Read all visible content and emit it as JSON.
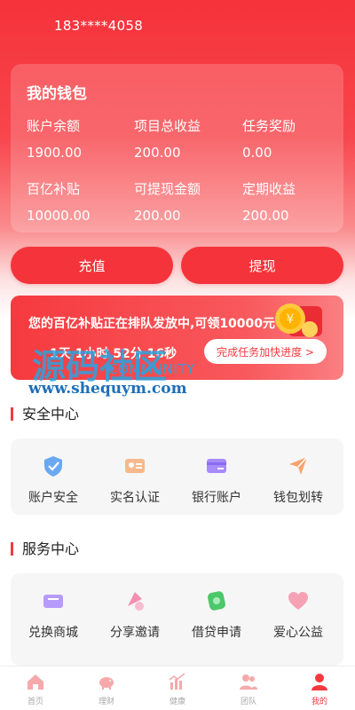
{
  "header": {
    "phone": "183****4058"
  },
  "wallet": {
    "title": "我的钱包",
    "stats": [
      {
        "label": "账户余额",
        "value": "1900.00"
      },
      {
        "label": "项目总收益",
        "value": "200.00"
      },
      {
        "label": "任务奖励",
        "value": "0.00"
      },
      {
        "label": "百亿补贴",
        "value": "10000.00"
      },
      {
        "label": "可提现金额",
        "value": "200.00"
      },
      {
        "label": "定期收益",
        "value": "200.00"
      }
    ]
  },
  "actions": {
    "recharge": "充值",
    "withdraw": "提现"
  },
  "banner": {
    "text": "您的百亿补贴正在排队发放中,可领10000元",
    "countdown": "1天 1小时 52分 16秒",
    "button": "完成任务加快进度 >"
  },
  "watermark": {
    "title": "源码社区",
    "sub": "COMMUNITY",
    "url": "www.shequym.com"
  },
  "security": {
    "title": "安全中心",
    "items": [
      {
        "label": "账户安全",
        "icon": "shield-icon"
      },
      {
        "label": "实名认证",
        "icon": "id-card-icon"
      },
      {
        "label": "银行账户",
        "icon": "bank-card-icon"
      },
      {
        "label": "钱包划转",
        "icon": "transfer-icon"
      }
    ]
  },
  "services": {
    "title": "服务中心",
    "items": [
      {
        "label": "兑换商城",
        "icon": "gift-card-icon"
      },
      {
        "label": "分享邀请",
        "icon": "share-icon"
      },
      {
        "label": "借贷申请",
        "icon": "loan-icon"
      },
      {
        "label": "爱心公益",
        "icon": "heart-icon"
      }
    ]
  },
  "tabbar": {
    "tabs": [
      {
        "label": "首页",
        "icon": "home-icon"
      },
      {
        "label": "理财",
        "icon": "piggy-bank-icon"
      },
      {
        "label": "健康",
        "icon": "health-icon"
      },
      {
        "label": "团队",
        "icon": "team-icon"
      },
      {
        "label": "我的",
        "icon": "user-icon"
      }
    ],
    "active_index": 4
  },
  "colors": {
    "accent": "#f33a3f",
    "watermark": "#2aa3df"
  }
}
